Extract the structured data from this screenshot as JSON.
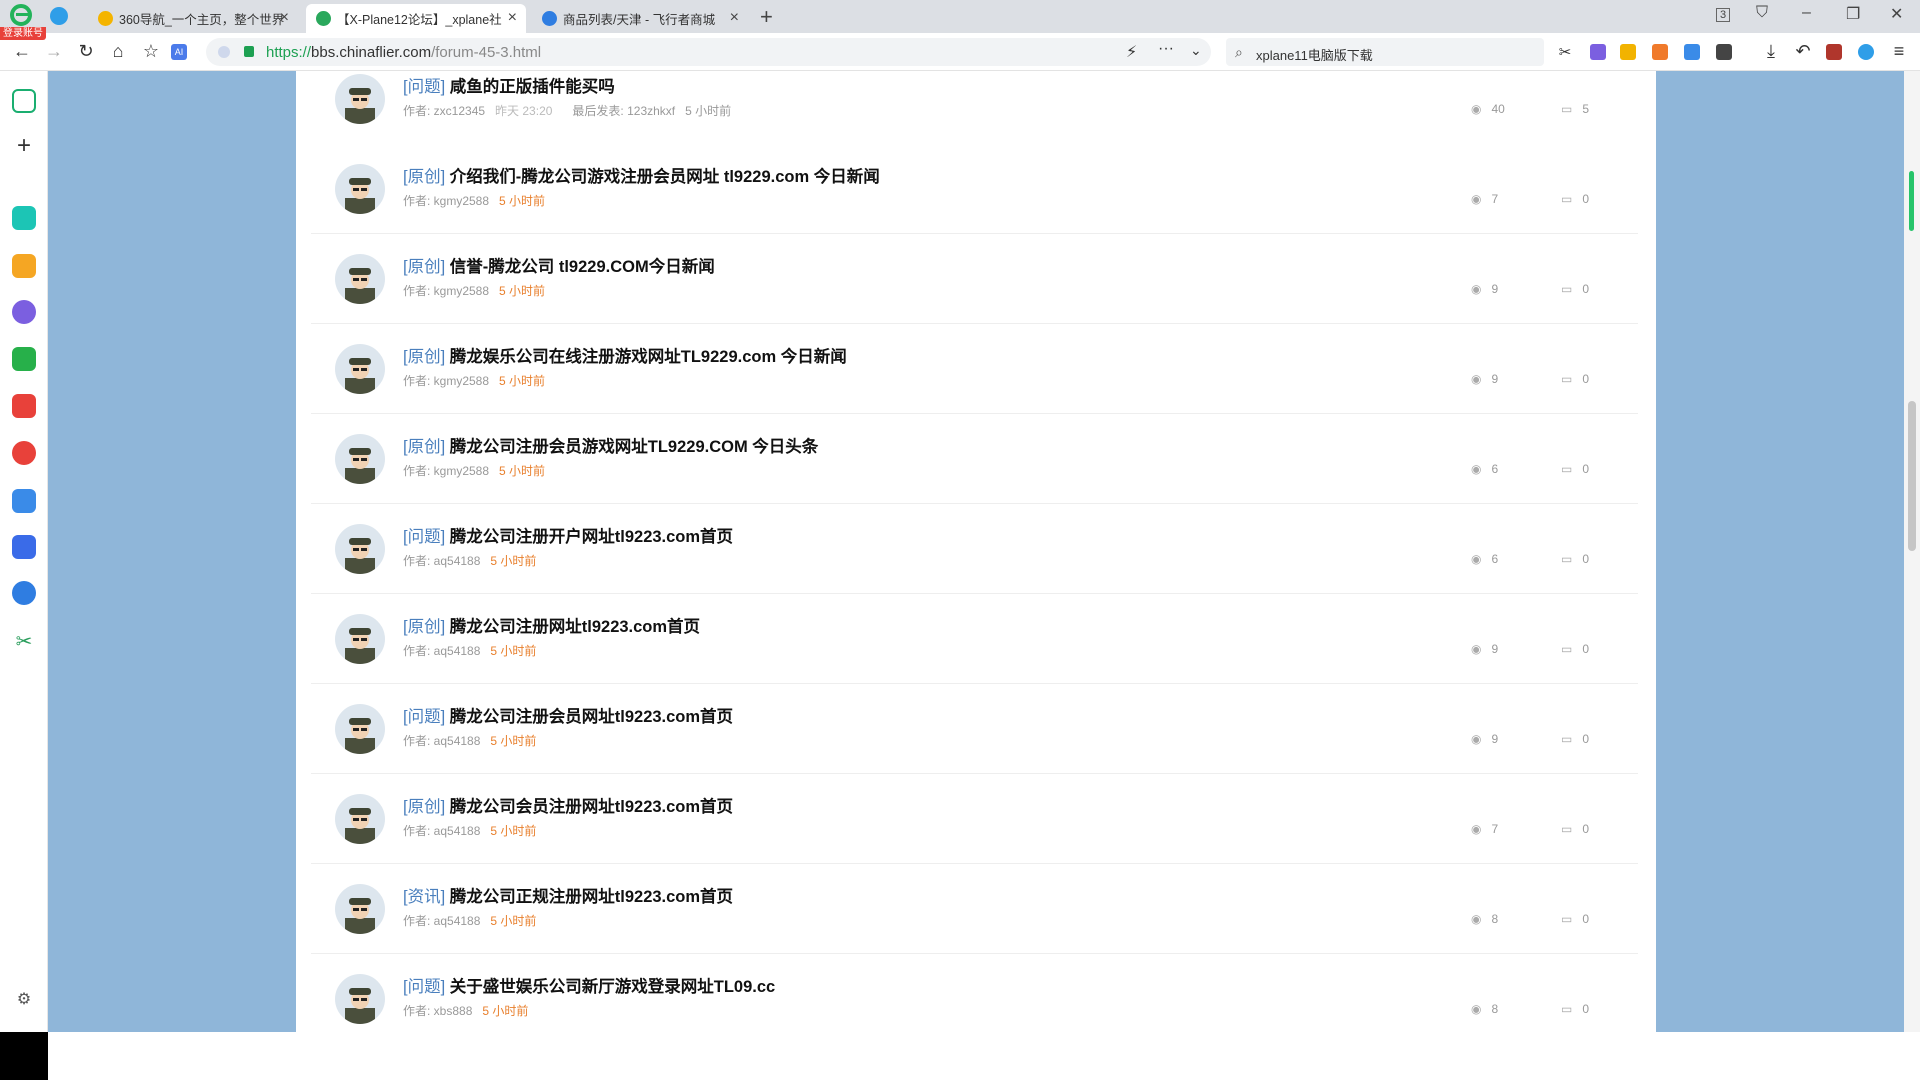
{
  "browser": {
    "login_badge": "登录账号",
    "tabs": [
      {
        "title": "360导航_一个主页，整个世界",
        "color": "#f4b400"
      },
      {
        "title": "【X-Plane12论坛】_xplane社",
        "color": "#2aa85c"
      },
      {
        "title": "商品列表/天津 - 飞行者商城",
        "color": "#2f7de1"
      }
    ],
    "new_tab": "+",
    "tab_count": "3",
    "address": {
      "scheme": "https://",
      "host": "bbs.chinaflier.com",
      "path": "/forum-45-3.html"
    },
    "search_text": "xplane11电脑版下载"
  },
  "threads": [
    {
      "tag": "[问题]",
      "title": "咸鱼的正版插件能买吗",
      "author": "作者: zxc12345",
      "date": "昨天 23:20",
      "last_post": "最后发表: 123zhkxf",
      "time": "5 小时前",
      "views": "40",
      "replies": "5",
      "first": true
    },
    {
      "tag": "[原创]",
      "title": "介绍我们-腾龙公司游戏注册会员网址 tl9229.com 今日新闻",
      "author": "作者: kgmy2588",
      "time": "5 小时前",
      "views": "7",
      "replies": "0"
    },
    {
      "tag": "[原创]",
      "title": "信誉-腾龙公司 tl9229.COM今日新闻",
      "author": "作者: kgmy2588",
      "time": "5 小时前",
      "views": "9",
      "replies": "0"
    },
    {
      "tag": "[原创]",
      "title": "腾龙娱乐公司在线注册游戏网址TL9229.com 今日新闻",
      "author": "作者: kgmy2588",
      "time": "5 小时前",
      "views": "9",
      "replies": "0"
    },
    {
      "tag": "[原创]",
      "title": "腾龙公司注册会员游戏网址TL9229.COM 今日头条",
      "author": "作者: kgmy2588",
      "time": "5 小时前",
      "views": "6",
      "replies": "0"
    },
    {
      "tag": "[问题]",
      "title": "腾龙公司注册开户网址tl9223.com首页",
      "author": "作者: aq54188",
      "time": "5 小时前",
      "views": "6",
      "replies": "0"
    },
    {
      "tag": "[原创]",
      "title": "腾龙公司注册网址tl9223.com首页",
      "author": "作者: aq54188",
      "time": "5 小时前",
      "views": "9",
      "replies": "0"
    },
    {
      "tag": "[问题]",
      "title": "腾龙公司注册会员网址tl9223.com首页",
      "author": "作者: aq54188",
      "time": "5 小时前",
      "views": "9",
      "replies": "0"
    },
    {
      "tag": "[原创]",
      "title": "腾龙公司会员注册网址tl9223.com首页",
      "author": "作者: aq54188",
      "time": "5 小时前",
      "views": "7",
      "replies": "0"
    },
    {
      "tag": "[资讯]",
      "title": "腾龙公司正规注册网址tl9223.com首页",
      "author": "作者: aq54188",
      "time": "5 小时前",
      "views": "8",
      "replies": "0"
    },
    {
      "tag": "[问题]",
      "title": "关于盛世娱乐公司新厅游戏登录网址TL09.cc",
      "author": "作者: xbs888",
      "time": "5 小时前",
      "views": "8",
      "replies": "0"
    }
  ]
}
